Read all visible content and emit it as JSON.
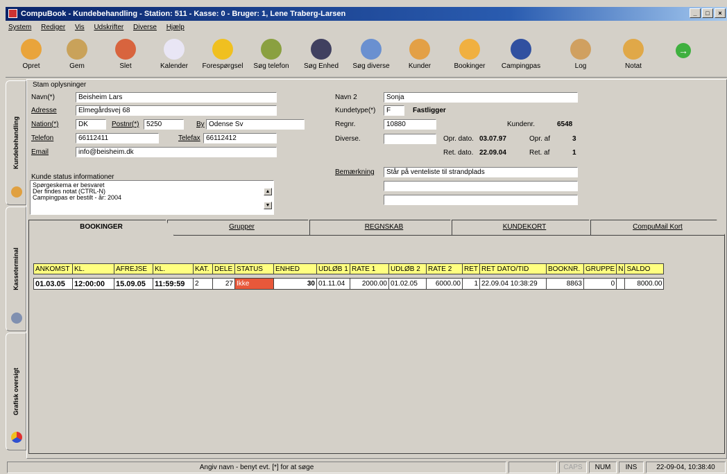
{
  "window": {
    "title": "CompuBook - Kundebehandling - Station: 511 - Kasse: 0 - Bruger: 1, Lene Traberg-Larsen"
  },
  "menu": [
    "System",
    "Rediger",
    "Vis",
    "Udskrifter",
    "Diverse",
    "Hjælp"
  ],
  "toolbar": [
    {
      "label": "Opret",
      "icon": "person-add-icon",
      "color": "#e9a43b"
    },
    {
      "label": "Gem",
      "icon": "person-save-icon",
      "color": "#c9a25a"
    },
    {
      "label": "Slet",
      "icon": "person-delete-icon",
      "color": "#d8643e"
    },
    {
      "label": "Kalender",
      "icon": "calendar-icon",
      "color": "#e9e6f5"
    },
    {
      "label": "Forespørgsel",
      "icon": "question-icon",
      "color": "#f0c020"
    },
    {
      "label": "Søg telefon",
      "icon": "phone-search-icon",
      "color": "#8aa040"
    },
    {
      "label": "Søg Enhed",
      "icon": "unit-search-icon",
      "color": "#404060"
    },
    {
      "label": "Søg diverse",
      "icon": "magnifier-icon",
      "color": "#6a90d0"
    },
    {
      "label": "Kunder",
      "icon": "customers-icon",
      "color": "#e3a046"
    },
    {
      "label": "Bookinger",
      "icon": "bookings-icon",
      "color": "#f0b040"
    },
    {
      "label": "Campingpas",
      "icon": "card-icon",
      "color": "#3050a0"
    },
    {
      "label": "Log",
      "icon": "log-icon",
      "color": "#d0a060"
    },
    {
      "label": "Notat",
      "icon": "note-icon",
      "color": "#e0a848"
    },
    {
      "label": "",
      "icon": "next-arrow-icon",
      "color": "#3fb03f"
    }
  ],
  "sidetabs": [
    {
      "label": "Kundebehandling"
    },
    {
      "label": "Kasseterminal"
    },
    {
      "label": "Grafisk oversigt"
    }
  ],
  "stam": {
    "group_title": "Stam oplysninger",
    "navn_label": "Navn(*)",
    "navn": "Beisheim Lars",
    "adresse_label": "Adresse",
    "adresse": "Elmegårdsvej 68",
    "nation_label": "Nation(*)",
    "nation": "DK",
    "postnr_label": "Postnr(*)",
    "postnr": "5250",
    "by_label": "By",
    "by": "Odense Sv",
    "telefon_label": "Telefon",
    "telefon": "66112411",
    "telefax_label": "Telefax",
    "telefax": "66112412",
    "email_label": "Email",
    "email": "info@beisheim.dk"
  },
  "status_info": {
    "group_title": "Kunde status informationer",
    "lines": [
      "Spørgeskema er besvaret",
      "Der findes notat (CTRL-N)",
      "Campingpas er bestilt - år: 2004"
    ]
  },
  "right": {
    "navn2_label": "Navn 2",
    "navn2": "Sonja",
    "kundetype_label": "Kundetype(*)",
    "kundetype": "F",
    "kundetype_text": "Fastligger",
    "regnr_label": "Regnr.",
    "regnr": "10880",
    "kundenr_label": "Kundenr.",
    "kundenr": "6548",
    "diverse_label": "Diverse.",
    "diverse": "",
    "opr_dato_label": "Opr. dato.",
    "opr_dato": "03.07.97",
    "opr_af_label": "Opr. af",
    "opr_af": "3",
    "ret_dato_label": "Ret. dato.",
    "ret_dato": "22.09.04",
    "ret_af_label": "Ret. af",
    "ret_af": "1",
    "bemaerkning_label": "Bemærkning",
    "bemaerkning": "Står på venteliste til strandplads",
    "bem2": "",
    "bem3": ""
  },
  "tabs": [
    "BOOKINGER",
    "Grupper",
    "REGNSKAB",
    "KUNDEKORT",
    "CompuMail Kort"
  ],
  "table": {
    "headers": [
      "ANKOMST",
      "KL.",
      "AFREJSE",
      "KL.",
      "KAT.",
      "DELE",
      "STATUS",
      "ENHED",
      "UDLØB 1",
      "RATE 1",
      "UDLØB 2",
      "RATE 2",
      "RET",
      "RET DATO/TID",
      "BOOKNR.",
      "GRUPPE",
      "N",
      "SALDO"
    ],
    "rows": [
      [
        "01.03.05",
        "12:00:00",
        "15.09.05",
        "11:59:59",
        "2",
        "27",
        "Ikke",
        "30",
        "01.11.04",
        "2000.00",
        "01.02.05",
        "6000.00",
        "1",
        "22.09.04 10:38:29",
        "8863",
        "0",
        "",
        "8000.00"
      ]
    ]
  },
  "statusbar": {
    "hint": "Angiv navn - benyt evt. [*] for at søge",
    "caps": "CAPS",
    "num": "NUM",
    "ins": "INS",
    "datetime": "22-09-04, 10:38:40"
  }
}
